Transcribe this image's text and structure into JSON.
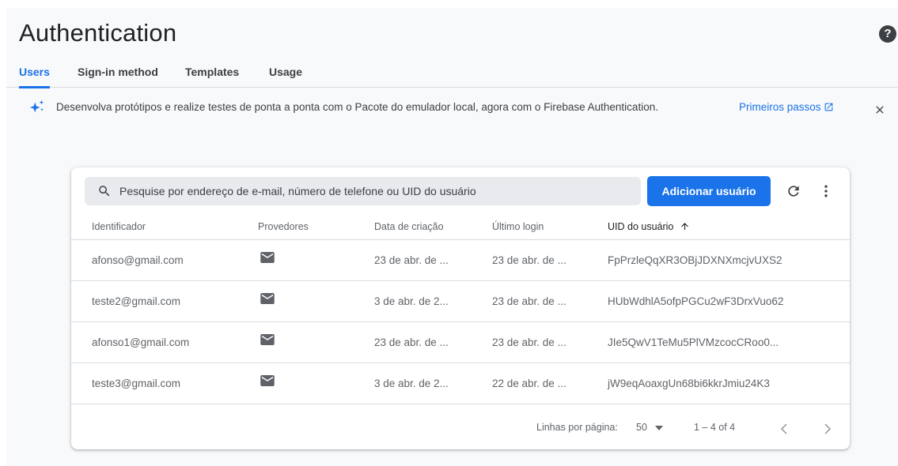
{
  "header": {
    "title": "Authentication",
    "help_icon": "help-icon"
  },
  "tabs": [
    {
      "label": "Users",
      "active": true
    },
    {
      "label": "Sign-in method",
      "active": false
    },
    {
      "label": "Templates",
      "active": false
    },
    {
      "label": "Usage",
      "active": false
    }
  ],
  "banner": {
    "icon": "sparkle-icon",
    "text": "Desenvolva protótipos e realize testes de ponta a ponta com o Pacote do emulador local, agora com o Firebase Authentication.",
    "link": "Primeiros passos",
    "link_icon": "external-link-icon",
    "close_icon": "close-icon"
  },
  "toolbar": {
    "search_placeholder": "Pesquise por endereço de e-mail, número de telefone ou UID do usuário",
    "add_button": "Adicionar usuário",
    "refresh_icon": "refresh-icon",
    "more_icon": "more-vert-icon"
  },
  "table": {
    "columns": [
      "Identificador",
      "Provedores",
      "Data de criação",
      "Último login",
      "UID do usuário"
    ],
    "sorted_column": "UID do usuário",
    "sort_direction": "ascending",
    "rows": [
      {
        "identifier": "afonso@gmail.com",
        "provider": "email-icon",
        "created": "23 de abr. de ...",
        "last_login": "23 de abr. de ...",
        "uid": "FpPrzleQqXR3OBjJDXNXmcjvUXS2"
      },
      {
        "identifier": "teste2@gmail.com",
        "provider": "email-icon",
        "created": "3 de abr. de 2...",
        "last_login": "23 de abr. de ...",
        "uid": "HUbWdhlA5ofpPGCu2wF3DrxVuo62"
      },
      {
        "identifier": "afonso1@gmail.com",
        "provider": "email-icon",
        "created": "23 de abr. de ...",
        "last_login": "23 de abr. de ...",
        "uid": "JIe5QwV1TeMu5PlVMzcocCRoo0..."
      },
      {
        "identifier": "teste3@gmail.com",
        "provider": "email-icon",
        "created": "3 de abr. de 2...",
        "last_login": "22 de abr. de ...",
        "uid": "jW9eqAoaxgUn68bi6kkrJmiu24K3"
      }
    ]
  },
  "pagination": {
    "rows_label": "Linhas por página:",
    "rows_per_page": "50",
    "range": "1 – 4 of 4"
  },
  "colors": {
    "accent": "#1a73e8",
    "background": "#f8f9fa",
    "text": "#202124",
    "muted": "#5f6368"
  }
}
